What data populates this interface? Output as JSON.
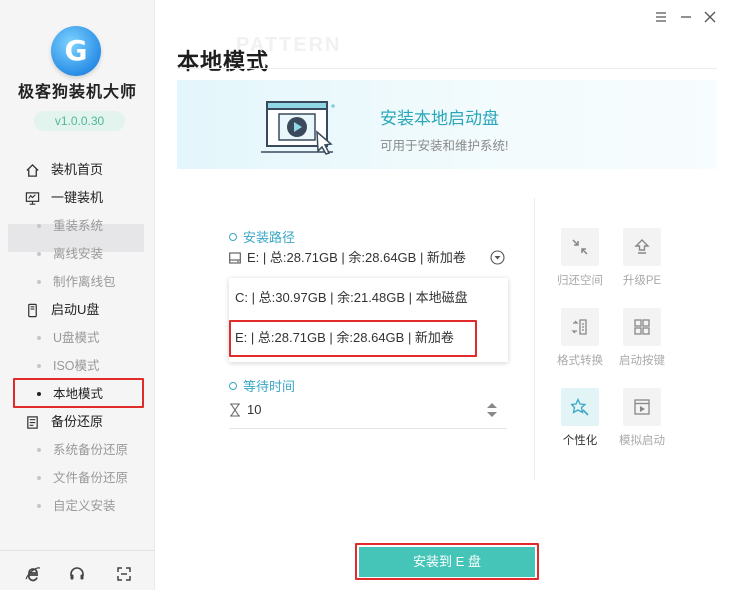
{
  "app": {
    "logo_letter": "G",
    "title": "极客狗装机大师",
    "version": "v1.0.0.30"
  },
  "sidebar": {
    "items": [
      {
        "label": "装机首页",
        "level": "top",
        "icon": "home-icon"
      },
      {
        "label": "一键装机",
        "level": "top",
        "icon": "monitor-icon"
      },
      {
        "label": "重装系统",
        "level": "sub"
      },
      {
        "label": "离线安装",
        "level": "sub"
      },
      {
        "label": "制作离线包",
        "level": "sub"
      },
      {
        "label": "启动U盘",
        "level": "top",
        "icon": "usb-drive-icon"
      },
      {
        "label": "U盘模式",
        "level": "sub"
      },
      {
        "label": "ISO模式",
        "level": "sub"
      },
      {
        "label": "本地模式",
        "level": "sub",
        "active": true
      },
      {
        "label": "备份还原",
        "level": "top",
        "icon": "backup-icon"
      },
      {
        "label": "系统备份还原",
        "level": "sub"
      },
      {
        "label": "文件备份还原",
        "level": "sub"
      },
      {
        "label": "自定义安装",
        "level": "sub"
      }
    ],
    "bottom_icons": [
      "ie-browser-icon",
      "headset-support-icon",
      "fullscreen-icon"
    ]
  },
  "window": {
    "controls": [
      "menu-icon",
      "minimize-icon",
      "close-icon"
    ]
  },
  "header": {
    "background_word": "PATTERN",
    "title": "本地模式"
  },
  "banner": {
    "heading": "安装本地启动盘",
    "subtext": "可用于安装和维护系统!"
  },
  "form": {
    "path_label": "安装路径",
    "selected_path": "E: | 总:28.71GB | 余:28.64GB | 新加卷",
    "options": [
      "C: | 总:30.97GB | 余:21.48GB | 本地磁盘",
      "E: | 总:28.71GB | 余:28.64GB | 新加卷"
    ],
    "wait_label": "等待时间",
    "wait_value": "10"
  },
  "tools": [
    {
      "label": "归还空间",
      "icon": "shrink-arrows-icon",
      "active": false
    },
    {
      "label": "升级PE",
      "icon": "upgrade-icon",
      "active": false
    },
    {
      "label": "格式转换",
      "icon": "file-convert-icon",
      "active": false
    },
    {
      "label": "启动按键",
      "icon": "keyboard-keys-icon",
      "active": false
    },
    {
      "label": "个性化",
      "icon": "star-brush-icon",
      "active": true
    },
    {
      "label": "模拟启动",
      "icon": "simulate-boot-icon",
      "active": false
    }
  ],
  "install_button": {
    "label": "安装到 E 盘"
  },
  "colors": {
    "accent": "#45c4b8",
    "link_blue": "#3aa7c5",
    "banner_text": "#2aa8b9",
    "highlight_red": "#e12a2a"
  }
}
